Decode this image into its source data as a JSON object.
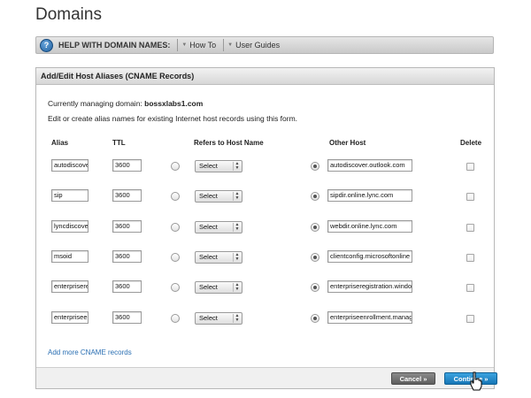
{
  "page": {
    "title": "Domains"
  },
  "help_bar": {
    "icon": "?",
    "label": "HELP WITH DOMAIN NAMES:",
    "links": [
      "How To",
      "User Guides"
    ]
  },
  "panel": {
    "title": "Add/Edit Host Aliases (CNAME Records)",
    "managing_label": "Currently managing domain:",
    "managing_domain": "bossxlabs1.com",
    "description": "Edit or create alias names for existing Internet host records using this form.",
    "columns": {
      "alias": "Alias",
      "ttl": "TTL",
      "refers": "Refers to Host Name",
      "other": "Other Host",
      "delete": "Delete"
    },
    "rows": [
      {
        "alias": "autodiscover",
        "ttl": "3600",
        "select": "Select",
        "other_host": "autodiscover.outlook.com"
      },
      {
        "alias": "sip",
        "ttl": "3600",
        "select": "Select",
        "other_host": "sipdir.online.lync.com"
      },
      {
        "alias": "lyncdiscover",
        "ttl": "3600",
        "select": "Select",
        "other_host": "webdir.online.lync.com"
      },
      {
        "alias": "msoid",
        "ttl": "3600",
        "select": "Select",
        "other_host": "clientconfig.microsoftonline"
      },
      {
        "alias": "enterpriseregistration",
        "ttl": "3600",
        "select": "Select",
        "other_host": "enterpriseregistration.windows"
      },
      {
        "alias": "enterpriseenrollment",
        "ttl": "3600",
        "select": "Select",
        "other_host": "enterpriseenrollment.manage"
      }
    ],
    "add_more": "Add more CNAME records",
    "cancel_label": "Cancel »",
    "continue_label": "Continue »"
  },
  "colors": {
    "link": "#2a6fb3",
    "continue": "#1676b6",
    "cancel": "#6e6e6e"
  }
}
